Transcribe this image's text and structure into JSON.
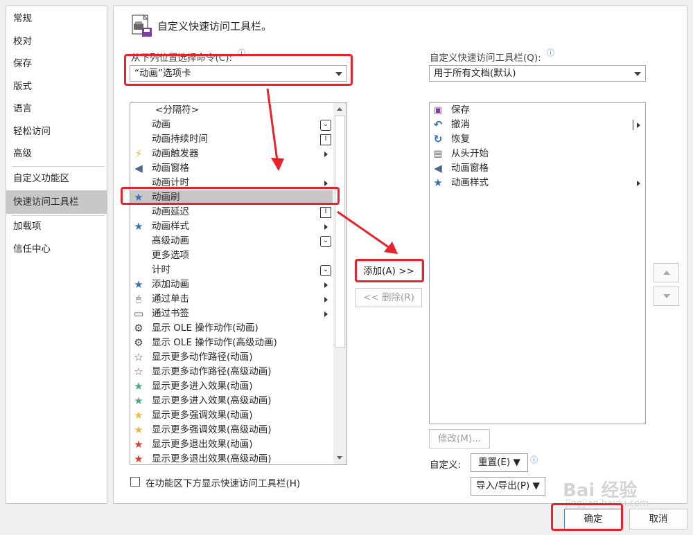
{
  "nav": {
    "items": [
      {
        "label": "常规"
      },
      {
        "label": "校对"
      },
      {
        "label": "保存"
      },
      {
        "label": "版式"
      },
      {
        "label": "语言"
      },
      {
        "label": "轻松访问"
      },
      {
        "label": "高级"
      },
      {
        "label": "自定义功能区"
      },
      {
        "label": "快速访问工具栏"
      },
      {
        "label": "加载项"
      },
      {
        "label": "信任中心"
      }
    ],
    "selected": "快速访问工具栏"
  },
  "header": {
    "title": "自定义快速访问工具栏。"
  },
  "left": {
    "choose_label": "从下列位置选择命令(C):",
    "choose_value": "“动画”选项卡",
    "commands": [
      {
        "label": "<分隔符>",
        "icon": ""
      },
      {
        "label": "动画",
        "icon": ""
      },
      {
        "label": "动画持续时间",
        "icon": ""
      },
      {
        "label": "动画触发器",
        "icon": "⚡"
      },
      {
        "label": "动画窗格",
        "icon": "◀"
      },
      {
        "label": "动画计时",
        "icon": ""
      },
      {
        "label": "动画刷",
        "icon": "★"
      },
      {
        "label": "动画延迟",
        "icon": ""
      },
      {
        "label": "动画样式",
        "icon": "★"
      },
      {
        "label": "高级动画",
        "icon": ""
      },
      {
        "label": "更多选项",
        "icon": ""
      },
      {
        "label": "计时",
        "icon": ""
      },
      {
        "label": "添加动画",
        "icon": "★"
      },
      {
        "label": "通过单击",
        "icon": "🖱"
      },
      {
        "label": "通过书签",
        "icon": "▭"
      },
      {
        "label": "显示 OLE 操作动作(动画)",
        "icon": "⚙"
      },
      {
        "label": "显示 OLE 操作动作(高级动画)",
        "icon": "⚙"
      },
      {
        "label": "显示更多动作路径(动画)",
        "icon": "☆"
      },
      {
        "label": "显示更多动作路径(高级动画)",
        "icon": "☆"
      },
      {
        "label": "显示更多进入效果(动画)",
        "icon": "★"
      },
      {
        "label": "显示更多进入效果(高级动画)",
        "icon": "★"
      },
      {
        "label": "显示更多强调效果(动画)",
        "icon": "★"
      },
      {
        "label": "显示更多强调效果(高级动画)",
        "icon": "★"
      },
      {
        "label": "显示更多退出效果(动画)",
        "icon": "★"
      },
      {
        "label": "显示更多退出效果(高级动画)",
        "icon": "★"
      }
    ],
    "selected": "动画刷",
    "show_below_label": "在功能区下方显示快速访问工具栏(H)"
  },
  "middle": {
    "add_label": "添加(A) >>",
    "remove_label": "<< 删除(R)"
  },
  "right": {
    "customize_label": "自定义快速访问工具栏(Q):",
    "customize_value": "用于所有文档(默认)",
    "items": [
      {
        "label": "保存",
        "icon": "💾"
      },
      {
        "label": "撤消",
        "icon": "↶"
      },
      {
        "label": "恢复",
        "icon": "↻"
      },
      {
        "label": "从头开始",
        "icon": "▣"
      },
      {
        "label": "动画窗格",
        "icon": "◀"
      },
      {
        "label": "动画样式",
        "icon": "★"
      }
    ],
    "modify_label": "修改(M)...",
    "custom_label": "自定义:",
    "reset_label": "重置(E) ▼",
    "import_export_label": "导入/导出(P) ▼"
  },
  "footer": {
    "ok_label": "确定",
    "cancel_label": "取消"
  },
  "watermark": {
    "brand": "Bai 经验",
    "url": "jingyan.baidu.com"
  },
  "colors": {
    "annotation_red": "#e8212a",
    "selected_gray": "#c6c6c6",
    "star_blue": "#3f6fb5",
    "star_teal": "#4aa88c",
    "star_gold": "#f0b64a",
    "star_red": "#d9412c",
    "bolt": "#f3b21b"
  }
}
